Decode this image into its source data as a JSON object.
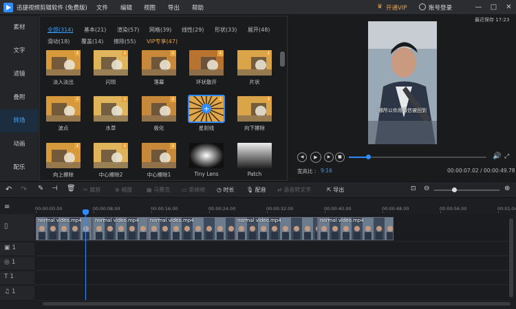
{
  "app": {
    "title": "迅捷视频剪辑软件 (免费版)",
    "menu": [
      "文件",
      "编辑",
      "视图",
      "导出",
      "帮助"
    ],
    "vip_label": "开通VIP",
    "login_label": "账号登录",
    "last_saved": "最近保存 17:23"
  },
  "sidebar": {
    "items": [
      {
        "label": "素材"
      },
      {
        "label": "文字"
      },
      {
        "label": "滤镜"
      },
      {
        "label": "叠附"
      },
      {
        "label": "转场"
      },
      {
        "label": "动画"
      },
      {
        "label": "配乐"
      }
    ],
    "active_index": 4
  },
  "transitions": {
    "tabs_row1": [
      "全部(314)",
      "基本(21)",
      "渲染(57)",
      "网格(39)",
      "线性(29)",
      "形状(33)",
      "展开(48)"
    ],
    "tabs_row2": [
      "滑动(18)",
      "覆盖(14)",
      "擦除(55)",
      "VIP专享(47)"
    ],
    "items": [
      {
        "label": "淡入淡出",
        "icon": "fade"
      },
      {
        "label": "闪现",
        "icon": "flash"
      },
      {
        "label": "落幕",
        "icon": "curtain"
      },
      {
        "label": "环状散开",
        "icon": "ring"
      },
      {
        "label": "片状",
        "icon": "shard"
      },
      {
        "label": "波点",
        "icon": "dots"
      },
      {
        "label": "水草",
        "icon": "weed"
      },
      {
        "label": "极化",
        "icon": "polar"
      },
      {
        "label": "星射线",
        "icon": "star-rays"
      },
      {
        "label": "向下擦除",
        "icon": "wipe-down"
      },
      {
        "label": "向上擦除",
        "icon": "wipe-up"
      },
      {
        "label": "中心擦除2",
        "icon": "center-wipe"
      },
      {
        "label": "中心擦除1",
        "icon": "center-wipe"
      },
      {
        "label": "Tiny Lens",
        "icon": "lens"
      },
      {
        "label": "Patch",
        "icon": "patch"
      }
    ]
  },
  "preview": {
    "subtitle": "哪所以你用微信被回到",
    "aspect_label": "宽高比 :",
    "aspect_value": "9:16",
    "current_time": "00:00:07.02",
    "total_time": "00:00:49.78",
    "progress": 0.14
  },
  "toolbar": {
    "split": "剪切",
    "crop": "裁剪",
    "zoom": "缩放",
    "mosaic": "马赛克",
    "add_frame": "添帧帧",
    "duration": "时长",
    "dub": "配音",
    "speech_to_text": "语音转文字",
    "export": "导出"
  },
  "timeline": {
    "ticks": [
      "00:00:00.00",
      "00:00:08.00",
      "00:00:16.00",
      "00:00:24.00",
      "00:00:32.00",
      "00:00:40.00",
      "00:00:48.00",
      "00:00:56.00",
      "00:01:04"
    ],
    "clips": [
      {
        "name": "normal video.mp4"
      },
      {
        "name": "normal video.mp4"
      },
      {
        "name": "normal video.mp4"
      },
      {
        "name": "normal video.mp4"
      },
      {
        "name": "normal video.mp4"
      }
    ]
  },
  "colors": {
    "accent": "#2f8cff",
    "vip": "#e8a14a",
    "background": "#1e1f22"
  }
}
